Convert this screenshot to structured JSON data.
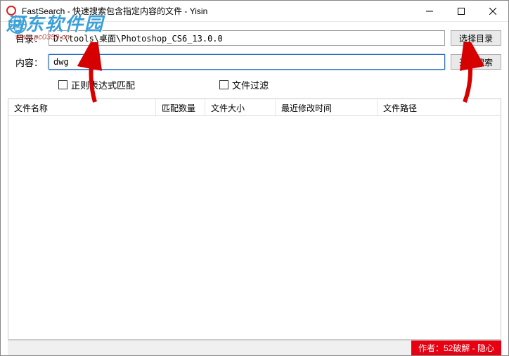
{
  "window": {
    "title": "FastSearch - 快速搜索包含指定内容的文件 - Yisin"
  },
  "watermark": {
    "main": "河东软件园",
    "url": "www.pc0359.cn"
  },
  "fields": {
    "dir_label": "目录：",
    "dir_value": "D:\\tools\\桌面\\Photoshop_CS6_13.0.0",
    "content_label": "内容：",
    "content_value": "dwg"
  },
  "buttons": {
    "choose_dir": "选择目录",
    "start_search": "开始搜索"
  },
  "checks": {
    "regex": "正则表达式匹配",
    "file_filter": "文件过滤"
  },
  "columns": {
    "name": "文件名称",
    "match_count": "匹配数量",
    "size": "文件大小",
    "mtime": "最近修改时间",
    "path": "文件路径"
  },
  "rows": [],
  "status": {
    "credit": "作者：52破解 - 隐心"
  }
}
